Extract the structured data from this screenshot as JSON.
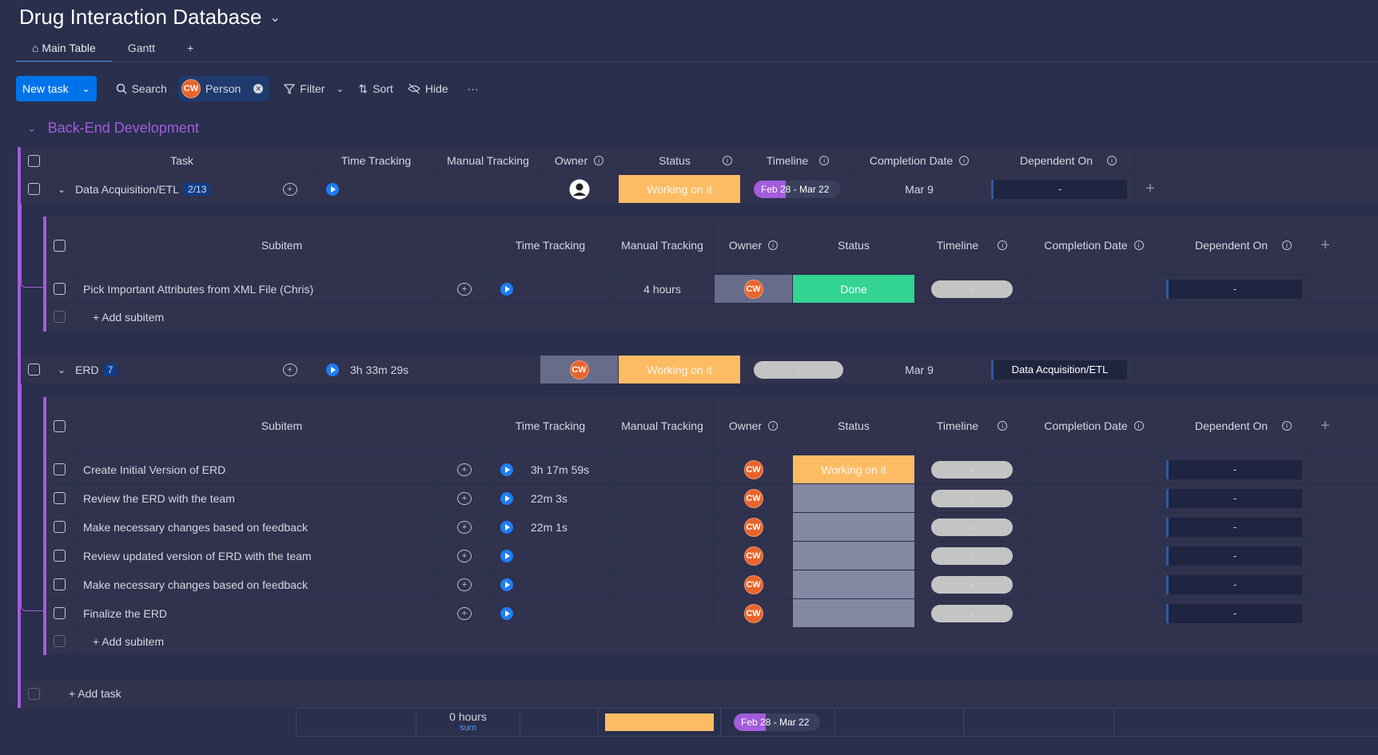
{
  "board": {
    "title": "Drug Interaction Database"
  },
  "tabs": [
    {
      "label": "Main Table"
    },
    {
      "label": "Gantt"
    },
    {
      "label": "+"
    }
  ],
  "toolbar": {
    "new_task": "New task",
    "search": "Search",
    "person_avatar": "CW",
    "person": "Person",
    "filter": "Filter",
    "sort": "Sort",
    "hide": "Hide",
    "more": "···"
  },
  "group": {
    "title": "Back-End Development",
    "color": "#a25ddc",
    "columns": {
      "task": "Task",
      "time_tracking": "Time Tracking",
      "manual_tracking": "Manual Tracking",
      "owner": "Owner",
      "status": "Status",
      "timeline": "Timeline",
      "completion_date": "Completion Date",
      "dependent_on": "Dependent On"
    },
    "items": [
      {
        "name": "Data Acquisition/ETL",
        "count": "2/13",
        "time": "",
        "manual": "",
        "owner": "",
        "status": "Working on it",
        "timeline": "Feb 28 - Mar 22",
        "completion": "Mar 9",
        "dependent": "-"
      },
      {
        "name": "ERD",
        "count": "7",
        "time": "3h 33m 29s",
        "manual": "",
        "owner": "CW",
        "status": "Working on it",
        "timeline": "-",
        "completion": "Mar 9",
        "dependent": "Data Acquisition/ETL"
      }
    ],
    "add_task": "+ Add task",
    "summary": {
      "manual_value": "0 hours",
      "manual_func": "sum",
      "timeline": "Feb 28 - Mar 22"
    }
  },
  "subtable": {
    "columns": {
      "subitem": "Subitem",
      "time_tracking": "Time Tracking",
      "manual_tracking": "Manual Tracking",
      "owner": "Owner",
      "status": "Status",
      "timeline": "Timeline",
      "completion_date": "Completion Date",
      "dependent_on": "Dependent On"
    },
    "add_subitem": "+ Add subitem",
    "etl_subitems": [
      {
        "name": "Pick Important Attributes from XML File (Chris)",
        "time": "",
        "manual": "4 hours",
        "owner": "CW",
        "status": "Done",
        "timeline": "-",
        "dependent": "-"
      }
    ],
    "erd_subitems": [
      {
        "name": "Create Initial Version of ERD",
        "time": "3h 17m 59s",
        "owner": "CW",
        "status": "Working on it",
        "timeline": "-",
        "dependent": "-"
      },
      {
        "name": "Review the ERD with the team",
        "time": "22m 3s",
        "owner": "CW",
        "status": "",
        "timeline": "-",
        "dependent": "-"
      },
      {
        "name": "Make necessary changes based on feedback",
        "time": "22m 1s",
        "owner": "CW",
        "status": "",
        "timeline": "-",
        "dependent": "-"
      },
      {
        "name": "Review updated version of ERD with the team",
        "time": "",
        "owner": "CW",
        "status": "",
        "timeline": "-",
        "dependent": "-"
      },
      {
        "name": "Make necessary changes based on feedback",
        "time": "",
        "owner": "CW",
        "status": "",
        "timeline": "-",
        "dependent": "-"
      },
      {
        "name": "Finalize the ERD",
        "time": "",
        "owner": "CW",
        "status": "",
        "timeline": "-",
        "dependent": "-"
      }
    ]
  },
  "colors": {
    "working": "#fdbc64",
    "done": "#33d391",
    "accent": "#0073ea"
  }
}
